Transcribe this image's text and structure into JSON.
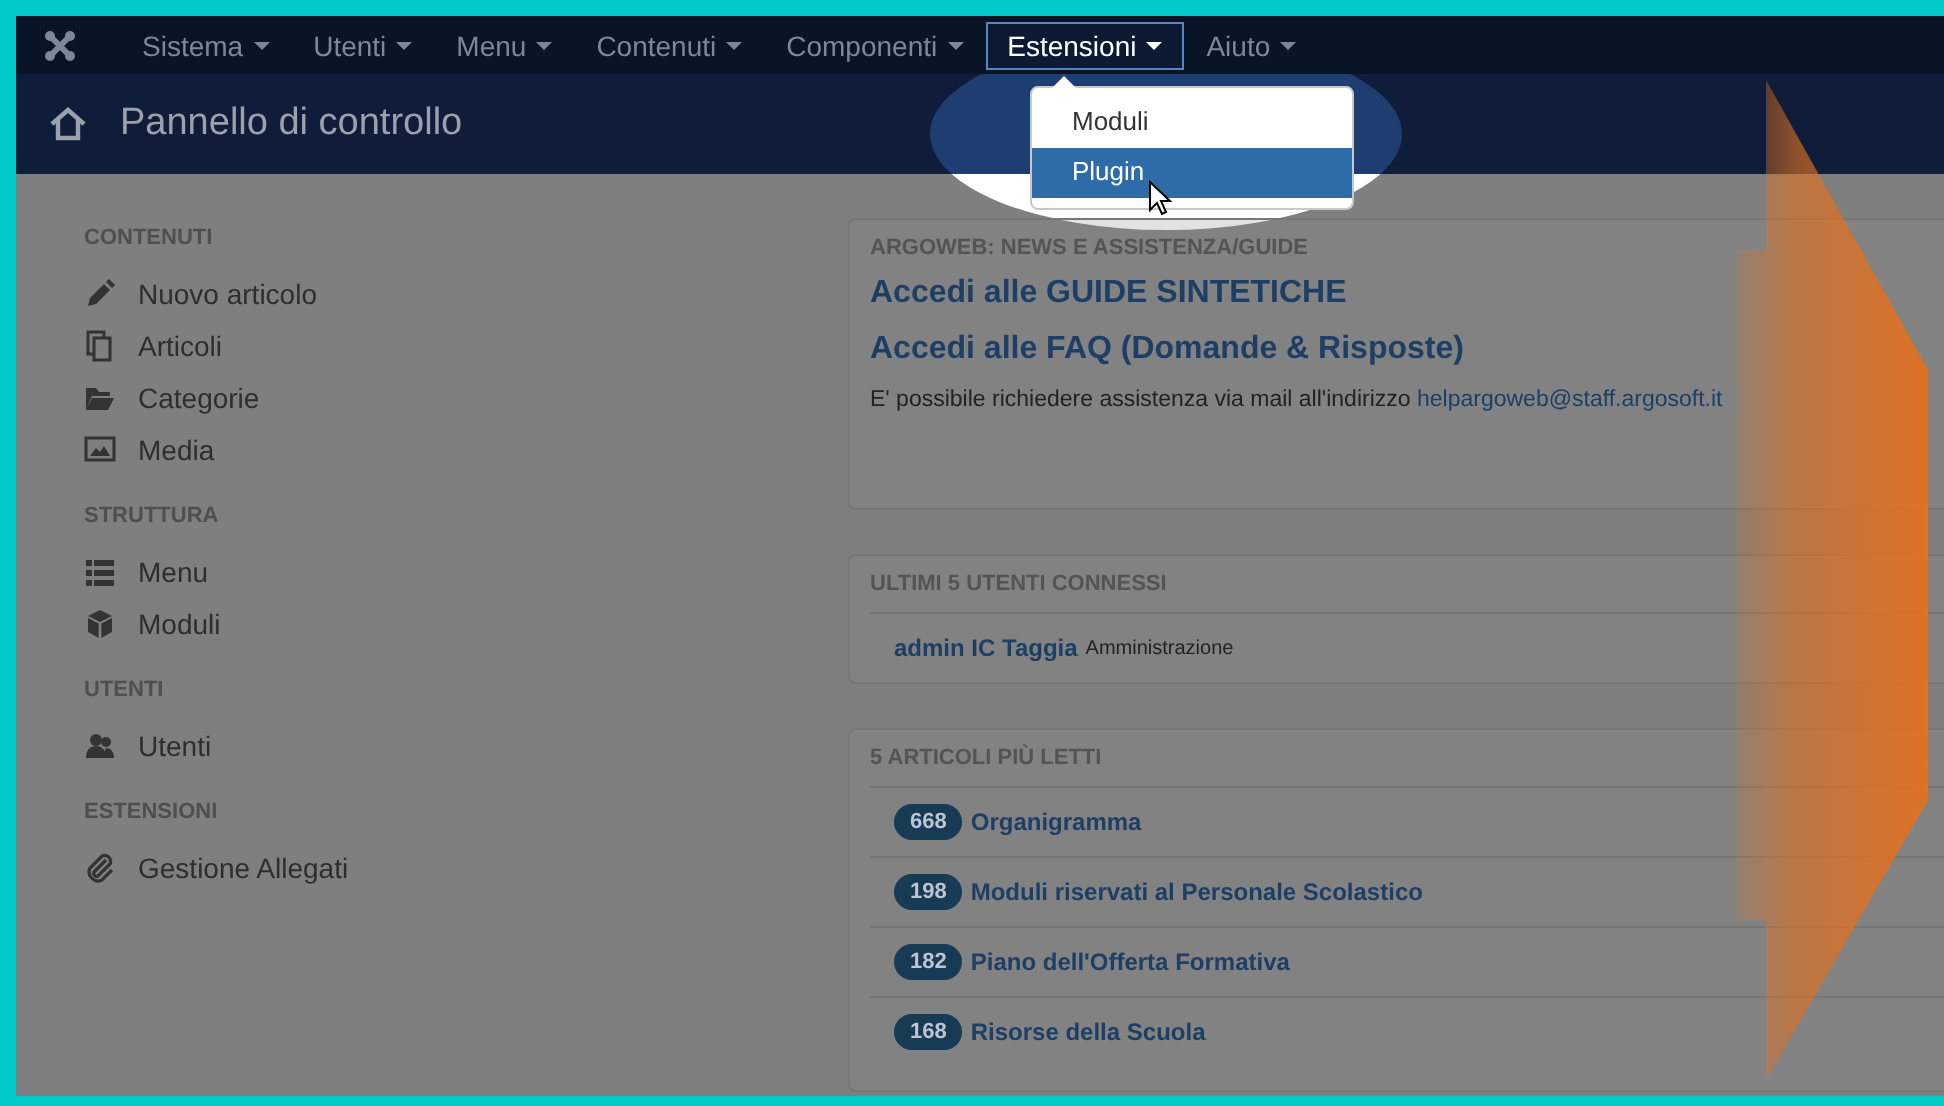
{
  "navbar": {
    "items": [
      {
        "label": "Sistema",
        "selected": false
      },
      {
        "label": "Utenti",
        "selected": false
      },
      {
        "label": "Menu",
        "selected": false
      },
      {
        "label": "Contenuti",
        "selected": false
      },
      {
        "label": "Componenti",
        "selected": false
      },
      {
        "label": "Estensioni",
        "selected": true
      },
      {
        "label": "Aiuto",
        "selected": false
      }
    ],
    "dropdown": {
      "items": [
        {
          "label": "Moduli",
          "selected": false
        },
        {
          "label": "Plugin",
          "selected": true
        }
      ]
    }
  },
  "header": {
    "title": "Pannello di controllo"
  },
  "sidebar": {
    "sections": [
      {
        "heading": "CONTENUTI",
        "items": [
          {
            "label": "Nuovo articolo",
            "kind": "pencil"
          },
          {
            "label": "Articoli",
            "kind": "copy"
          },
          {
            "label": "Categorie",
            "kind": "folder"
          },
          {
            "label": "Media",
            "kind": "image"
          }
        ]
      },
      {
        "heading": "STRUTTURA",
        "items": [
          {
            "label": "Menu",
            "kind": "list"
          },
          {
            "label": "Moduli",
            "kind": "cube"
          }
        ]
      },
      {
        "heading": "UTENTI",
        "items": [
          {
            "label": "Utenti",
            "kind": "users"
          }
        ]
      },
      {
        "heading": "ESTENSIONI",
        "items": [
          {
            "label": "Gestione Allegati",
            "kind": "paperclip"
          }
        ]
      }
    ]
  },
  "panels": [
    {
      "kind": "news",
      "heading": "ARGOWEB: NEWS E ASSISTENZA/GUIDE",
      "links": [
        "Accedi alle GUIDE SINTETICHE",
        "Accedi alle FAQ (Domande & Risposte)"
      ],
      "text": "E' possibile richiedere assistenza via mail all'indirizzo",
      "email": "helpargoweb@staff.argosoft.it"
    },
    {
      "kind": "users",
      "heading": "ULTIMI 5 UTENTI CONNESSI",
      "rows": [
        {
          "name": "admin IC Taggia",
          "role": "Amministrazione"
        }
      ]
    },
    {
      "kind": "articles",
      "heading": "5 ARTICOLI PIÙ LETTI",
      "rows": [
        {
          "count": "668",
          "title": "Organigramma"
        },
        {
          "count": "198",
          "title": "Moduli riservati al Personale Scolastico"
        },
        {
          "count": "182",
          "title": "Piano dell'Offerta Formativa"
        },
        {
          "count": "168",
          "title": "Risorse della Scuola"
        }
      ]
    }
  ]
}
